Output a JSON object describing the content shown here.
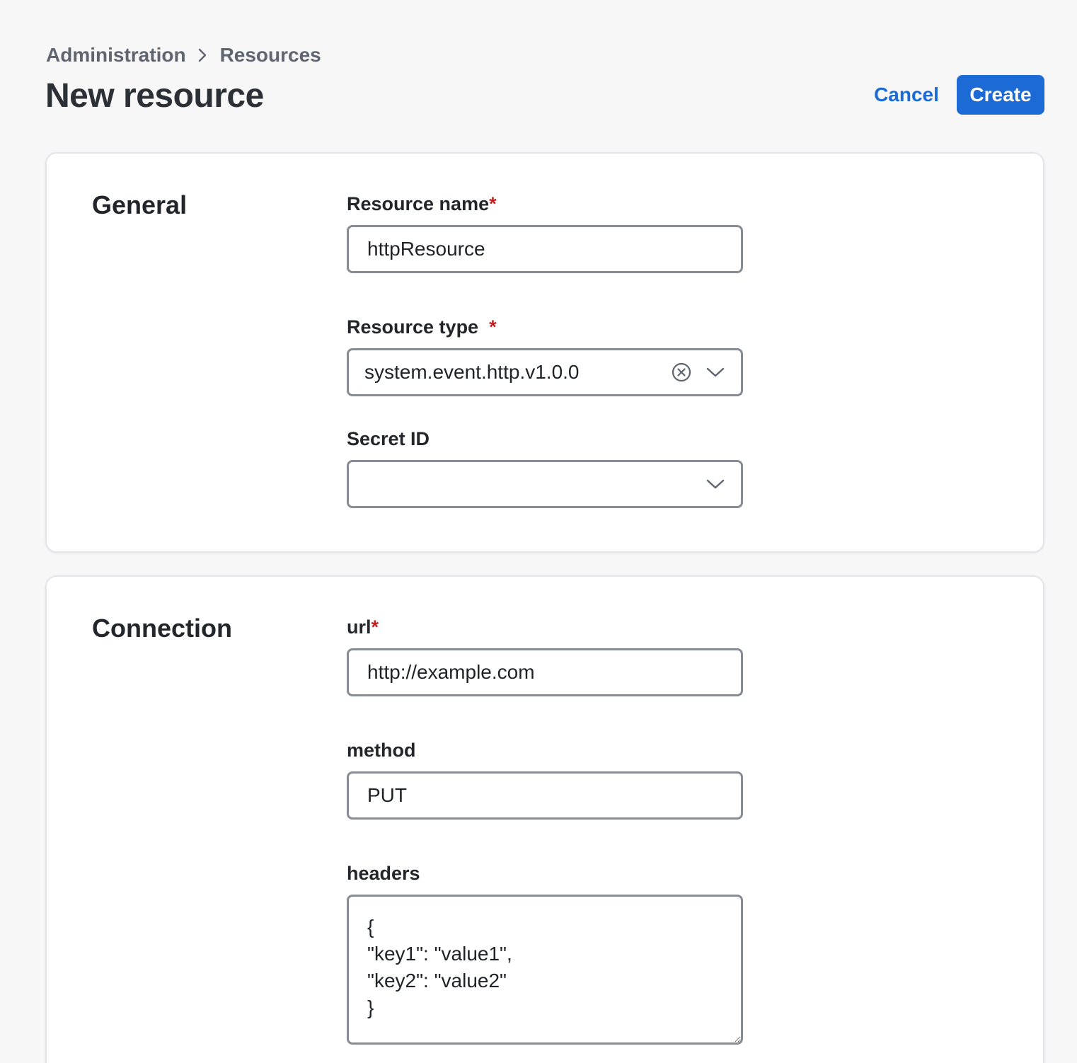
{
  "breadcrumb": {
    "items": [
      "Administration",
      "Resources"
    ]
  },
  "header": {
    "title": "New resource",
    "cancel_label": "Cancel",
    "create_label": "Create"
  },
  "general": {
    "section_title": "General",
    "resource_name": {
      "label": "Resource name",
      "required_mark": "*",
      "value": "httpResource"
    },
    "resource_type": {
      "label": "Resource type",
      "required_mark": "*",
      "value": "system.event.http.v1.0.0"
    },
    "secret_id": {
      "label": "Secret ID",
      "value": ""
    }
  },
  "connection": {
    "section_title": "Connection",
    "url": {
      "label": "url",
      "required_mark": "*",
      "value": "http://example.com"
    },
    "method": {
      "label": "method",
      "value": "PUT"
    },
    "headers": {
      "label": "headers",
      "value": "{\n\"key1\": \"value1\",\n\"key2\": \"value2\"\n}"
    }
  },
  "colors": {
    "accent": "#1c6ad6",
    "required": "#c81e1e",
    "background": "#f7f7f8"
  },
  "icons": [
    "chevron-right-icon",
    "clear-circle-icon",
    "chevron-down-icon"
  ]
}
